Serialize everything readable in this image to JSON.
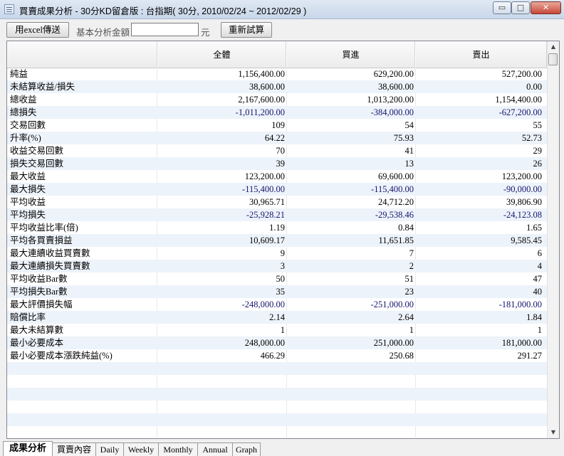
{
  "window": {
    "title": "買賣成果分析 - 30分KD留倉版 : 台指期( 30分, 2010/02/24 ~ 2012/02/29 )",
    "minimize": "▭",
    "maximize": "□",
    "close": "✕"
  },
  "toolbar": {
    "export_label": "用excel傳送",
    "amount_label": "基本分析金額",
    "amount_value": "",
    "unit_label": "元",
    "recalc_label": "重新試算"
  },
  "table": {
    "headers": [
      "",
      "全體",
      "買進",
      "賣出"
    ],
    "rows": [
      {
        "label": "純益",
        "all": "1,156,400.00",
        "buy": "629,200.00",
        "sell": "527,200.00"
      },
      {
        "label": "未結算收益/損失",
        "all": "38,600.00",
        "buy": "38,600.00",
        "sell": "0.00"
      },
      {
        "label": "總收益",
        "all": "2,167,600.00",
        "buy": "1,013,200.00",
        "sell": "1,154,400.00"
      },
      {
        "label": "總損失",
        "all": "-1,011,200.00",
        "buy": "-384,000.00",
        "sell": "-627,200.00"
      },
      {
        "label": "交易回數",
        "all": "109",
        "buy": "54",
        "sell": "55"
      },
      {
        "label": "升率(%)",
        "all": "64.22",
        "buy": "75.93",
        "sell": "52.73"
      },
      {
        "label": "收益交易回數",
        "all": "70",
        "buy": "41",
        "sell": "29"
      },
      {
        "label": "損失交易回數",
        "all": "39",
        "buy": "13",
        "sell": "26"
      },
      {
        "label": "最大收益",
        "all": "123,200.00",
        "buy": "69,600.00",
        "sell": "123,200.00"
      },
      {
        "label": "最大損失",
        "all": "-115,400.00",
        "buy": "-115,400.00",
        "sell": "-90,000.00"
      },
      {
        "label": "平均收益",
        "all": "30,965.71",
        "buy": "24,712.20",
        "sell": "39,806.90"
      },
      {
        "label": "平均損失",
        "all": "-25,928.21",
        "buy": "-29,538.46",
        "sell": "-24,123.08"
      },
      {
        "label": "平均收益比率(倍)",
        "all": "1.19",
        "buy": "0.84",
        "sell": "1.65"
      },
      {
        "label": "平均各買賣損益",
        "all": "10,609.17",
        "buy": "11,651.85",
        "sell": "9,585.45"
      },
      {
        "label": "最大連續收益買賣數",
        "all": "9",
        "buy": "7",
        "sell": "6"
      },
      {
        "label": "最大連續損失買賣數",
        "all": "3",
        "buy": "2",
        "sell": "4"
      },
      {
        "label": "平均收益Bar數",
        "all": "50",
        "buy": "51",
        "sell": "47"
      },
      {
        "label": "平均損失Bar數",
        "all": "35",
        "buy": "23",
        "sell": "40"
      },
      {
        "label": "最大評價損失幅",
        "all": "-248,000.00",
        "buy": "-251,000.00",
        "sell": "-181,000.00"
      },
      {
        "label": "賠償比率",
        "all": "2.14",
        "buy": "2.64",
        "sell": "1.84"
      },
      {
        "label": "最大未結算數",
        "all": "1",
        "buy": "1",
        "sell": "1"
      },
      {
        "label": "最小必要成本",
        "all": "248,000.00",
        "buy": "251,000.00",
        "sell": "181,000.00"
      },
      {
        "label": "最小必要成本漲跌純益(%)",
        "all": "466.29",
        "buy": "250.68",
        "sell": "291.27"
      }
    ],
    "empty_rows": 6
  },
  "scrollbar": {
    "up": "▲",
    "down": "▼"
  },
  "tabs": [
    {
      "label": "成果分析",
      "active": true
    },
    {
      "label": "買賣內容",
      "active": false
    },
    {
      "label": "Daily",
      "active": false
    },
    {
      "label": "Weekly",
      "active": false
    },
    {
      "label": "Monthly",
      "active": false
    },
    {
      "label": "Annual",
      "active": false
    },
    {
      "label": "Graph",
      "active": false
    }
  ],
  "colors": {
    "negative": "#16166e",
    "stripe": "#edf3fa",
    "close_button": "#c7483a"
  }
}
